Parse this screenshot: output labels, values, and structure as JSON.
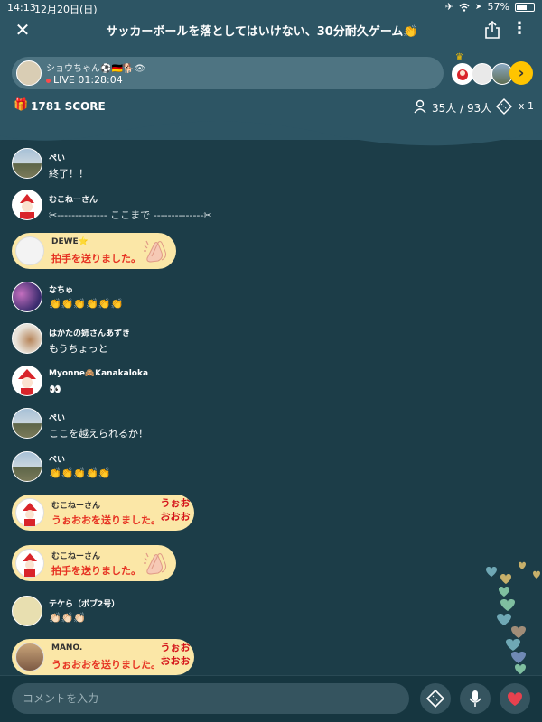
{
  "status_bar": {
    "time": "14:13",
    "date": "12月20日(日)",
    "battery": "57%"
  },
  "header": {
    "title": "サッカーボールを落としてはいけない、30分耐久ゲーム👏"
  },
  "host": {
    "name": "ショウちゃん⚽🇩🇪🐕👁",
    "live_label": "LIVE",
    "elapsed": "01:28:04"
  },
  "score": {
    "label": "1781 SCORE",
    "viewers": "35人 / 93人",
    "tickets": "x 1"
  },
  "messages": [
    {
      "type": "text",
      "name": "ぺい",
      "text": "終了！！",
      "avatar": "mountain"
    },
    {
      "type": "text",
      "name": "むこねーさん",
      "text": "✂-------------- ここまで --------------✂",
      "avatar": "santa"
    },
    {
      "type": "gift",
      "name": "DEWE⭐",
      "text": "拍手を送りました。",
      "gift": "clap"
    },
    {
      "type": "text",
      "name": "なちゅ",
      "text": "👏👏👏👏👏👏",
      "avatar": "purple"
    },
    {
      "type": "text",
      "name": "はかたの姉さんあずき",
      "text": "もうちょっと",
      "avatar": "dog"
    },
    {
      "type": "text",
      "name": "Myonne🙈Kanakaloka",
      "text": "👀",
      "avatar": "santa"
    },
    {
      "type": "text",
      "name": "ぺい",
      "text": "ここを越えられるか！",
      "avatar": "mountain"
    },
    {
      "type": "text",
      "name": "ぺい",
      "text": "👏👏👏👏👏",
      "avatar": "mountain"
    },
    {
      "type": "gift",
      "name": "むこねーさん",
      "text": "うぉおおを送りました。",
      "gift": "uoo"
    },
    {
      "type": "gift",
      "name": "むこねーさん",
      "text": "拍手を送りました。",
      "gift": "clap"
    },
    {
      "type": "text",
      "name": "テケら（ボブ2号）",
      "text": "👏🏻👏🏻👏🏻",
      "avatar": "cartoon"
    },
    {
      "type": "gift",
      "name": "MANO.",
      "text": "うぉおおを送りました。",
      "gift": "uoo"
    }
  ],
  "gift_art": {
    "uoo_text": "うぉお おおお"
  },
  "input": {
    "placeholder": "コメントを入力"
  },
  "colors": {
    "bg": "#1c3d48",
    "top_bg": "#2d5564",
    "gift_bubble": "#fbe7a7",
    "gift_text": "#e63222",
    "accent": "#ffc400",
    "heart": "#e8414e"
  }
}
